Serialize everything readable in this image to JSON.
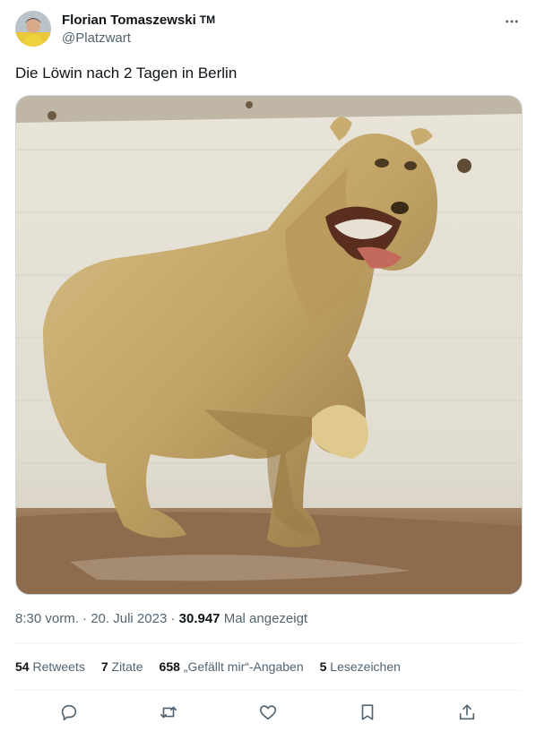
{
  "author": {
    "display_name": "Florian Tomaszewski",
    "badge": "TM",
    "handle": "@Platzwart"
  },
  "tweet": {
    "text": "Die Löwin nach 2 Tagen in Berlin"
  },
  "meta": {
    "time": "8:30 vorm.",
    "date": "20. Juli 2023",
    "views_count": "30.947",
    "views_label": "Mal angezeigt"
  },
  "stats": {
    "retweets_count": "54",
    "retweets_label": "Retweets",
    "quotes_count": "7",
    "quotes_label": "Zitate",
    "likes_count": "658",
    "likes_label": "„Gefällt mir“-Angaben",
    "bookmarks_count": "5",
    "bookmarks_label": "Lesezeichen"
  },
  "icons": {
    "more": "more-horizontal-icon",
    "reply": "reply-icon",
    "retweet": "retweet-icon",
    "like": "heart-icon",
    "bookmark": "bookmark-icon",
    "share": "share-icon"
  }
}
